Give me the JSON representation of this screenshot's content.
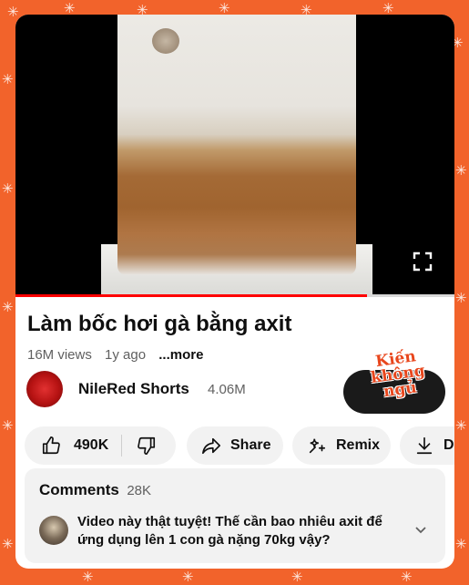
{
  "video": {
    "title": "Làm bốc hơi gà bằng axit",
    "progress": 0.8
  },
  "meta": {
    "views": "16M views",
    "age": "1y ago",
    "more": "...more"
  },
  "channel": {
    "name": "NileRed Shorts",
    "subscribers": "4.06M"
  },
  "sticker": {
    "text": "Kiến không ngủ"
  },
  "actions": {
    "like_count": "490K",
    "share_label": "Share",
    "remix_label": "Remix",
    "download_label": "Do"
  },
  "comments": {
    "title": "Comments",
    "count": "28K",
    "top_comment": "Video này thật tuyệt! Thế cần bao nhiêu axit để ứng dụng lên 1 con gà nặng 70kg vậy?"
  },
  "colors": {
    "background": "#f2632b",
    "progress": "#ff0000",
    "pill": "#f2f2f2"
  }
}
